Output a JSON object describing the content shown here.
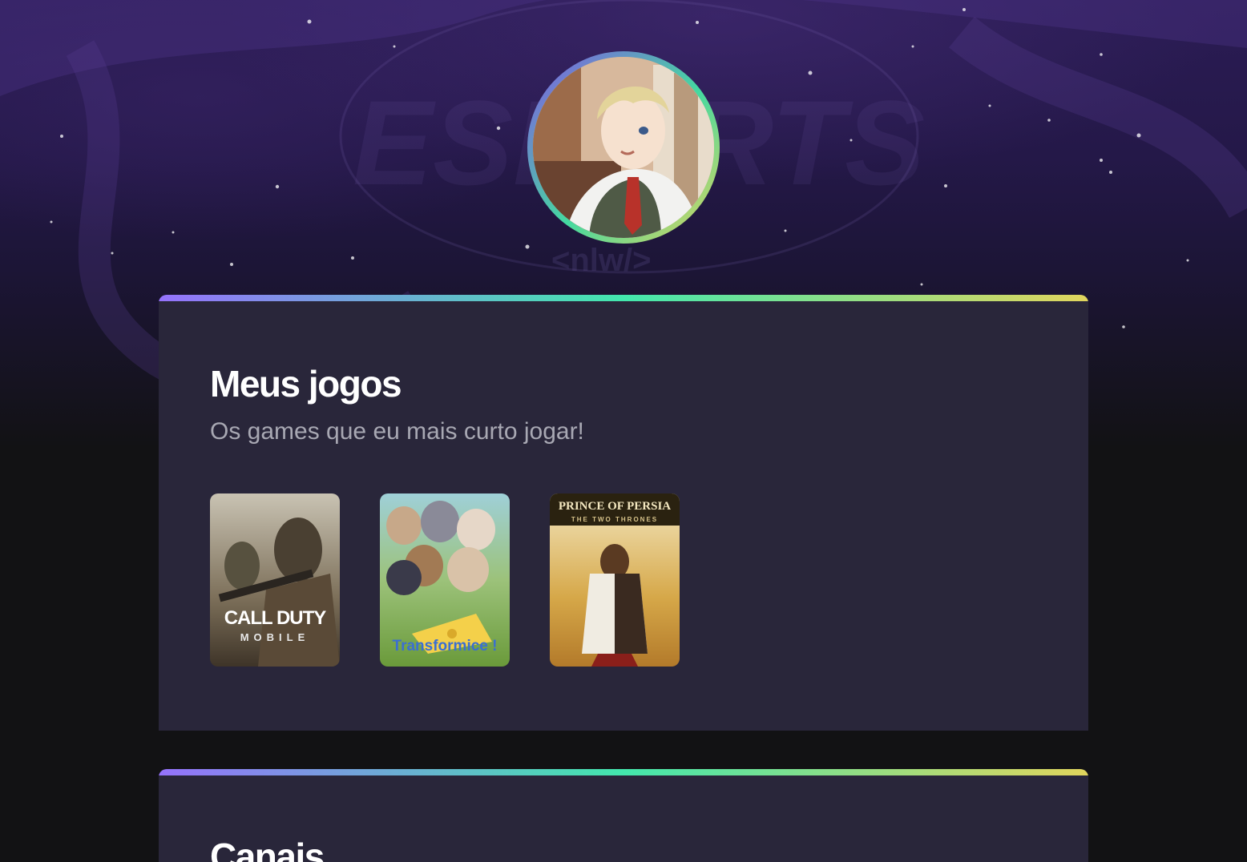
{
  "profile": {
    "avatar_alt": "avatar",
    "background_logo_text": "ESPORTS",
    "background_tag_text": "<nlw/>"
  },
  "games_section": {
    "title": "Meus jogos",
    "subtitle": "Os games que eu mais curto jogar!",
    "games": [
      {
        "name": "Call of Duty Mobile",
        "cover_line1": "CALL DUTY",
        "cover_line2": "MOBILE"
      },
      {
        "name": "Transformice",
        "cover_line1": "Transformice !"
      },
      {
        "name": "Prince of Persia",
        "cover_line1": "PRINCE OF PERSIA",
        "cover_line2": "THE TWO THRONES"
      }
    ]
  },
  "channels_section": {
    "title": "Canais"
  },
  "colors": {
    "background": "#121214",
    "card": "#29263a",
    "gradient_start": "#9572fc",
    "gradient_mid": "#43e7ad",
    "gradient_end": "#e1d55d",
    "subtitle": "#a8a8b3"
  }
}
